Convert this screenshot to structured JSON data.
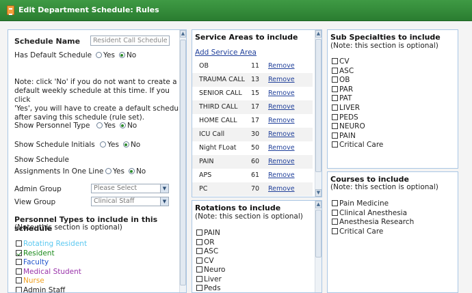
{
  "window": {
    "title": "Edit Department Schedule: Rules",
    "title_icon": "schedule-icon"
  },
  "left": {
    "schedule_name_label": "Schedule Name",
    "schedule_name_value": "Resident Call Schedule",
    "has_default_label": "Has Default Schedule",
    "note": "Note: click 'No' if you do not want to create a default weekly schedule at this time. If you click 'Yes', you will have to create a default schedule after saving this schedule (rule set).",
    "note_lines": [
      "Note: click 'No' if you do not want to create a",
      "default weekly schedule at this time. If you click",
      "'Yes', you will have to create a default schedule",
      "after saving this schedule (rule set)."
    ],
    "show_personnel_label": "Show Personnel Type",
    "show_initials_label": "Show Schedule Initials",
    "show_assign_label_1": "Show Schedule",
    "show_assign_label_2": "Assignments In One Line",
    "yes": "Yes",
    "no": "No",
    "admin_group_label": "Admin Group",
    "admin_group_value": "Please Select",
    "view_group_label": "View Group",
    "view_group_value": "Clinical Staff",
    "personnel_title": "Personnel Types to include in this schedule",
    "personnel_note": "(Note: this section is optional)",
    "personnel_types": [
      {
        "label": "Rotating Resident",
        "checked": false,
        "color": "#5bc8f0"
      },
      {
        "label": "Resident",
        "checked": true,
        "color": "#1a8a1a"
      },
      {
        "label": "Faculty",
        "checked": false,
        "color": "#2255cc"
      },
      {
        "label": "Medical Student",
        "checked": false,
        "color": "#9933aa"
      },
      {
        "label": "Nurse",
        "checked": false,
        "color": "#f0a020"
      },
      {
        "label": "Admin Staff",
        "checked": false,
        "color": "#222222"
      }
    ]
  },
  "service_areas": {
    "title": "Service Areas to include",
    "add_link": "Add Service Area",
    "remove_label": "Remove",
    "rows": [
      {
        "name": "OB",
        "code": "11"
      },
      {
        "name": "TRAUMA CALL",
        "code": "13"
      },
      {
        "name": "SENIOR CALL",
        "code": "15"
      },
      {
        "name": "THIRD CALL",
        "code": "17"
      },
      {
        "name": "HOME CALL",
        "code": "17"
      },
      {
        "name": "ICU Call",
        "code": "30"
      },
      {
        "name": "Night FLoat",
        "code": "50"
      },
      {
        "name": "PAIN",
        "code": "60"
      },
      {
        "name": "APS",
        "code": "61"
      },
      {
        "name": "PC",
        "code": "70"
      }
    ]
  },
  "rotations": {
    "title": "Rotations to include",
    "note": "(Note: this section is optional)",
    "items": [
      "PAIN",
      "OR",
      "ASC",
      "CV",
      "Neuro",
      "Liver",
      "Peds"
    ]
  },
  "sub_specialties": {
    "title": "Sub Specialties to include",
    "note": "(Note: this section is optional)",
    "items": [
      "CV",
      "ASC",
      "OB",
      "PAR",
      "PAT",
      "LIVER",
      "PEDS",
      "NEURO",
      "PAIN",
      "Critical Care"
    ]
  },
  "courses": {
    "title": "Courses to include",
    "note": "(Note: this section is optional)",
    "items": [
      "Pain Medicine",
      "Clinical Anesthesia",
      "Anesthesia Research",
      "Critical Care"
    ]
  }
}
